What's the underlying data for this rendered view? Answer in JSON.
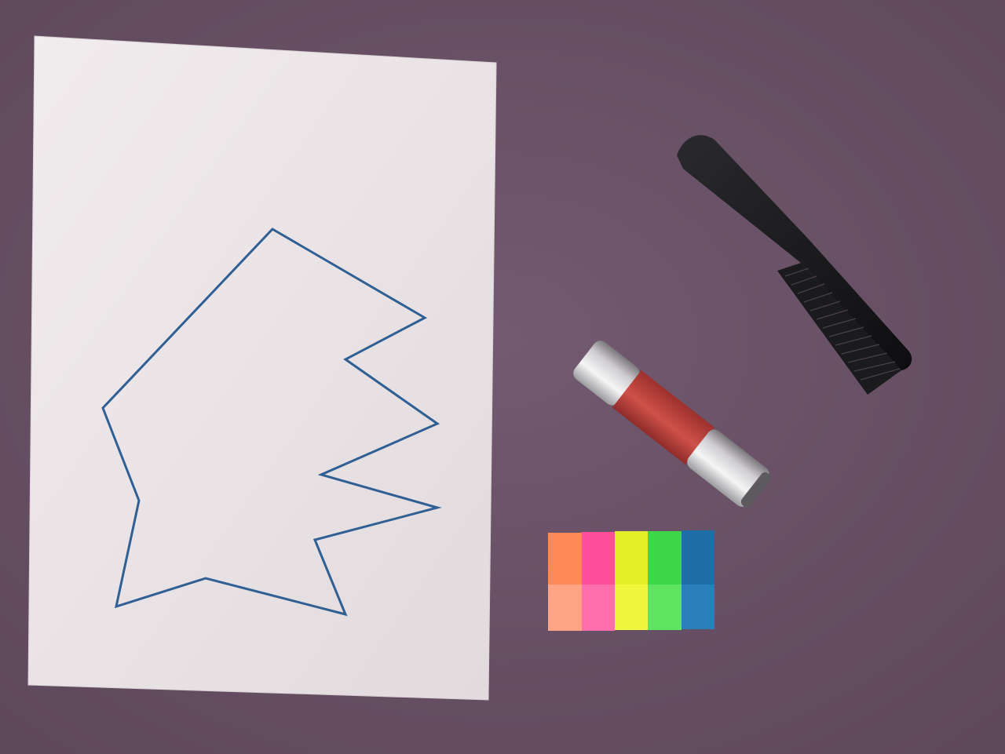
{
  "scene": {
    "background": "table-surface",
    "objects": [
      {
        "name": "paper-sheet",
        "color": "#ece6e8"
      },
      {
        "name": "drawn-polygon",
        "color": "#2f5f93",
        "shape": "irregular polygon outline drawn in blue marker"
      },
      {
        "name": "comb",
        "color": "#151518"
      },
      {
        "name": "lipstick-tube",
        "band_color": "#c2473e",
        "cap_color": "#e6e4e4"
      },
      {
        "name": "sticky-note-tabs",
        "colors": [
          "#ff8a55",
          "#ff4f9b",
          "#e4ef2a",
          "#40d64a",
          "#1f6ea8"
        ]
      }
    ]
  },
  "colors": {
    "table": "#6a5368",
    "paper": "#ece6e8",
    "ink": "#2f5f93"
  }
}
